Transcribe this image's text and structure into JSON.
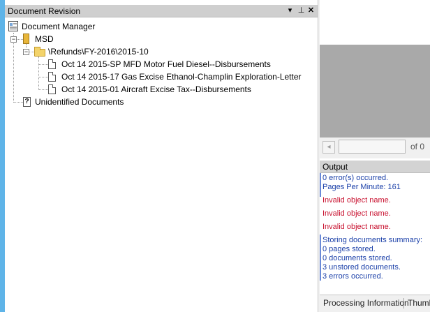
{
  "panel": {
    "title": "Document Revision",
    "controls": [
      "▾",
      "⊥",
      "✕"
    ]
  },
  "tree": {
    "root_label": "Document Manager",
    "cabinet_label": "MSD",
    "folder_label": "\\Refunds\\FY-2016\\2015-10",
    "documents": [
      "Oct 14 2015-SP MFD Motor Fuel Diesel--Disbursements",
      "Oct 14 2015-17 Gas Excise Ethanol-Champlin Exploration-Letter",
      "Oct 14 2015-01 Aircraft Excise Tax--Disbursements"
    ],
    "unidentified_label": "Unidentified Documents"
  },
  "viewer": {
    "page_value": "",
    "of_label": "of 0"
  },
  "output": {
    "title": "Output",
    "group1": [
      "0 error(s) occurred.",
      "Pages Per Minute: 161"
    ],
    "errors": [
      "Invalid object name.",
      "Invalid object name.",
      "Invalid object name."
    ],
    "summary": [
      "Storing documents summary:",
      "0 pages stored.",
      "0 documents stored.",
      "3 unstored documents.",
      "3 errors occurred."
    ]
  },
  "tabs": [
    "Processing Information",
    "Thumb"
  ],
  "colors": {
    "accent_strip": "#5fb4e8",
    "info_text": "#1a3fa8",
    "error_text": "#c8102e"
  }
}
